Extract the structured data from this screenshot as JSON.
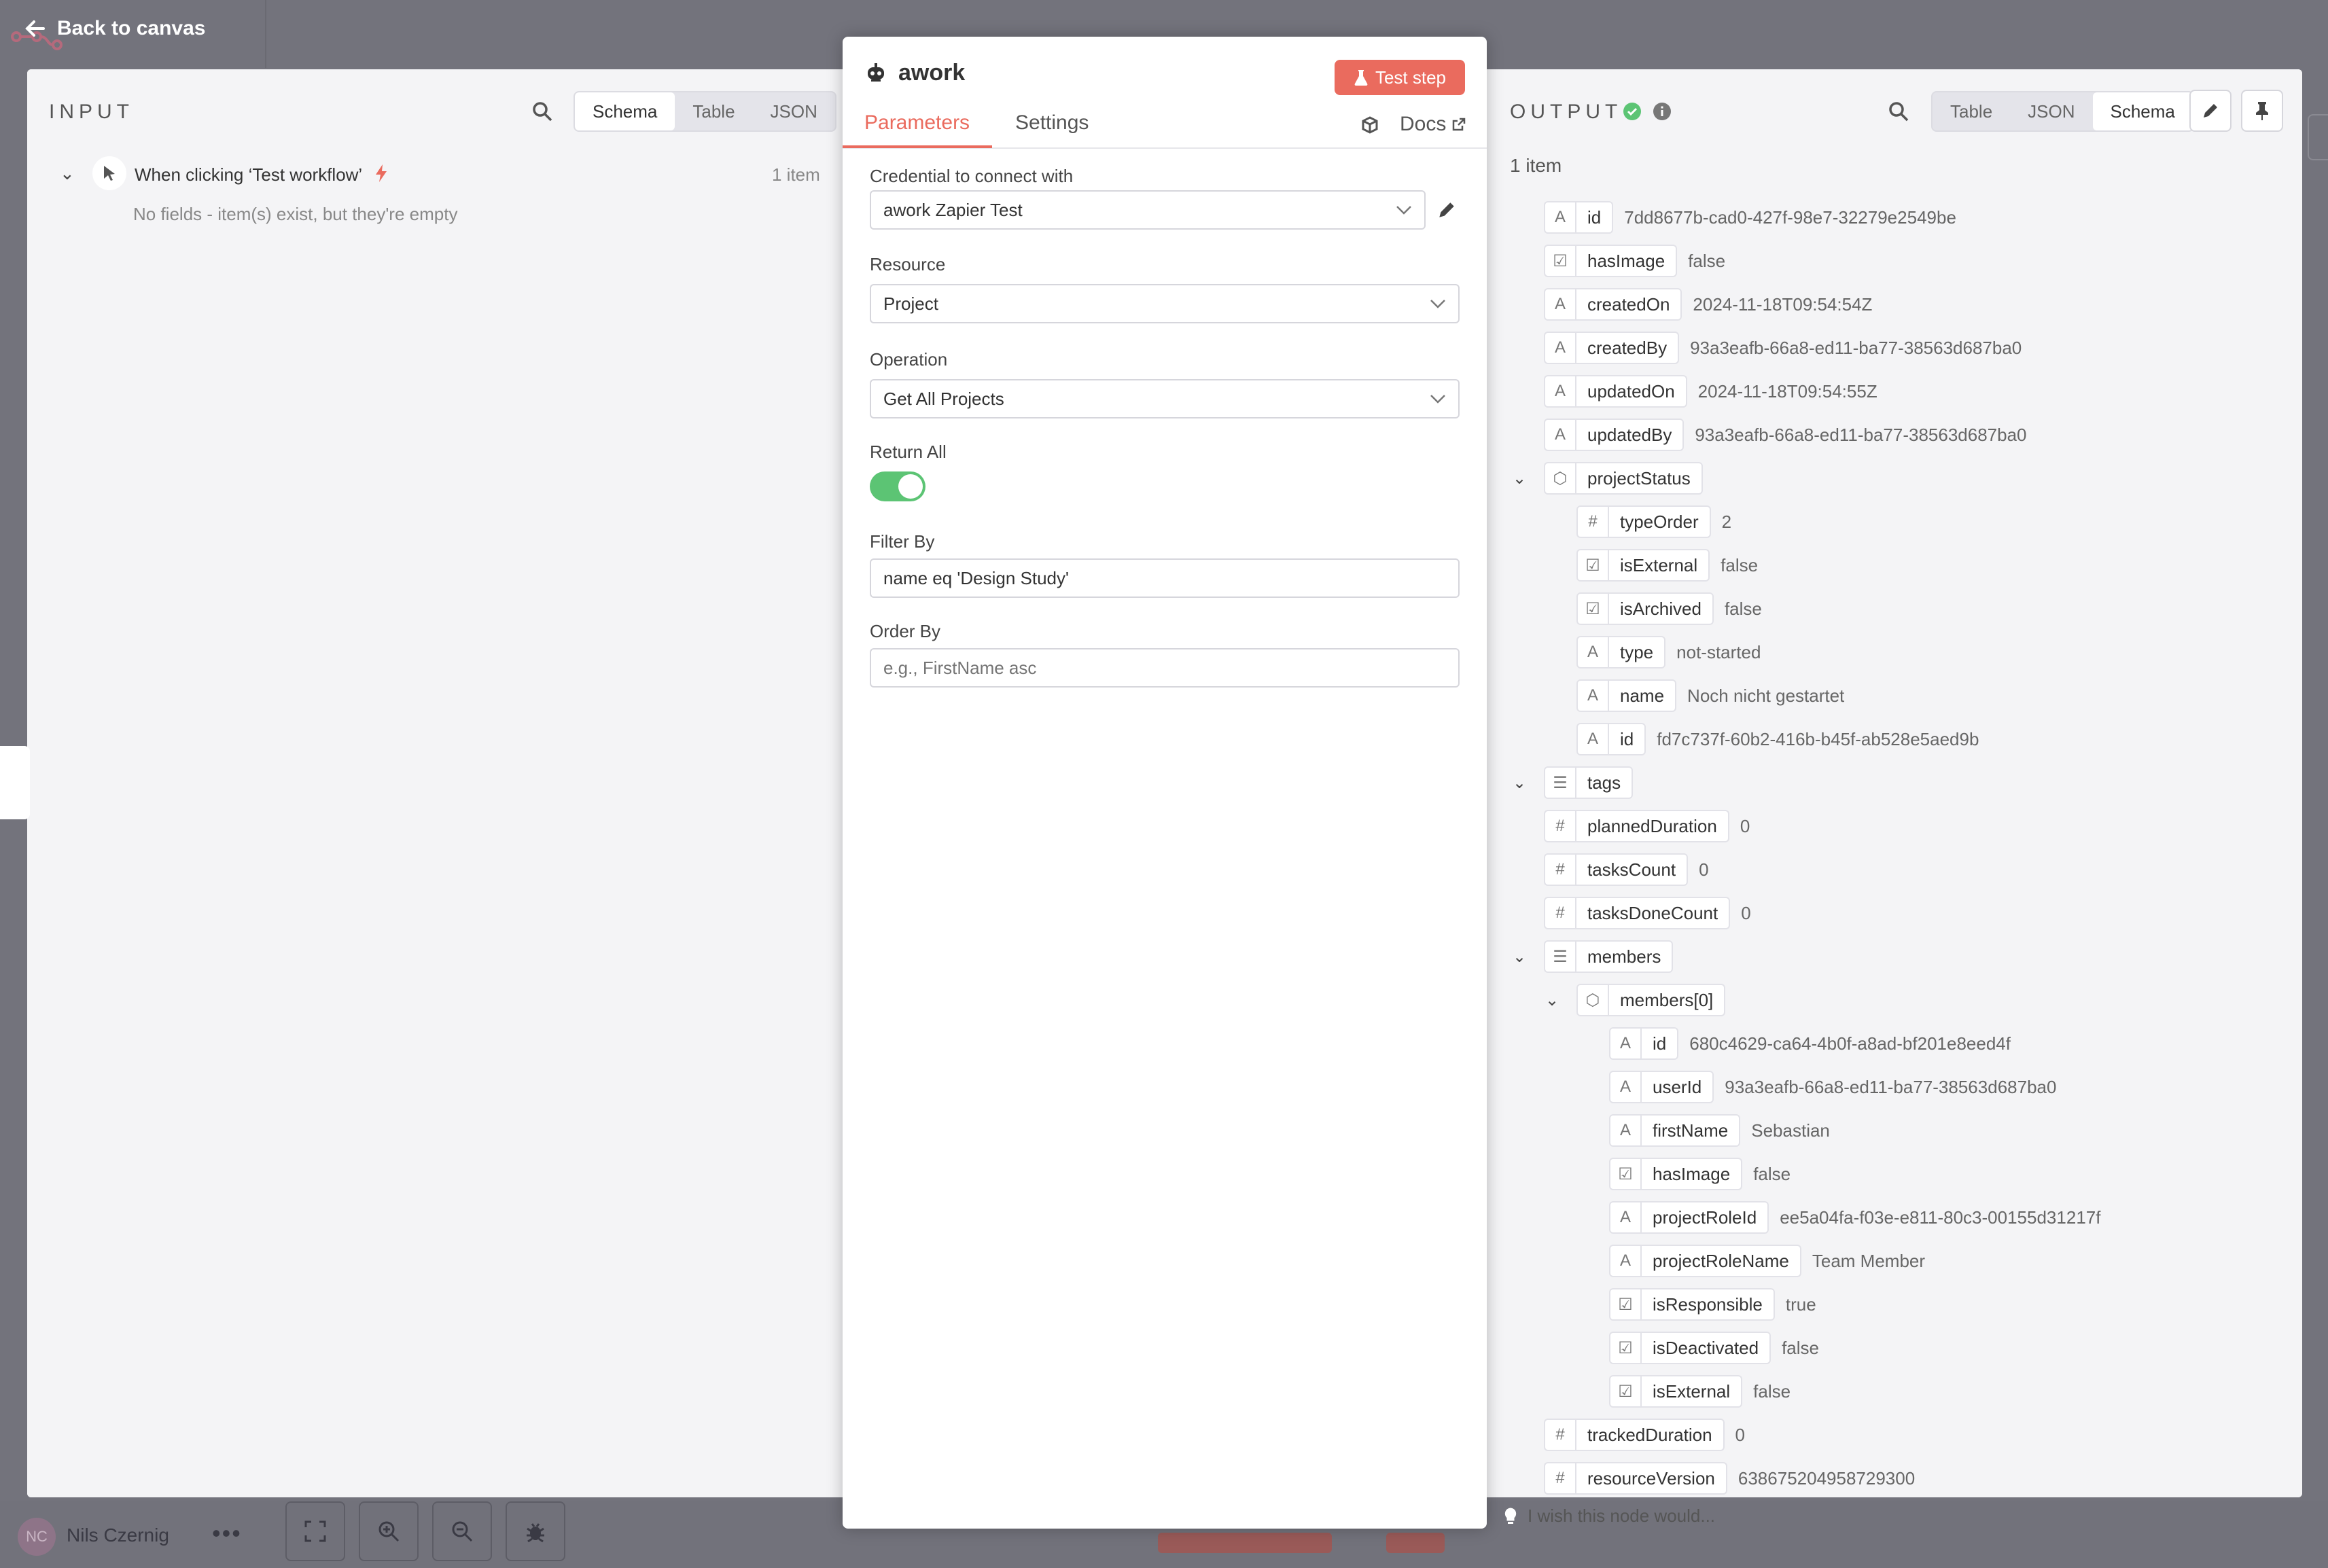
{
  "topbar": {
    "back_label": "Back to canvas"
  },
  "input": {
    "title": "INPUT",
    "view_tabs": [
      "Schema",
      "Table",
      "JSON"
    ],
    "active_tab": "Schema",
    "trigger_name": "When clicking ‘Test workflow’",
    "item_count": "1 item",
    "empty_message": "No fields - item(s) exist, but they're empty"
  },
  "node": {
    "name": "awork",
    "test_button": "Test step",
    "tabs": [
      "Parameters",
      "Settings"
    ],
    "docs_label": "Docs",
    "credential_label": "Credential to connect with",
    "credential_value": "awork Zapier Test",
    "resource_label": "Resource",
    "resource_value": "Project",
    "operation_label": "Operation",
    "operation_value": "Get All Projects",
    "return_all_label": "Return All",
    "return_all": true,
    "filter_label": "Filter By",
    "filter_value": "name eq 'Design Study'",
    "order_label": "Order By",
    "order_placeholder": "e.g., FirstName asc"
  },
  "output": {
    "title": "OUTPUT",
    "item_count": "1 item",
    "view_tabs": [
      "Table",
      "JSON",
      "Schema"
    ],
    "active_tab": "Schema",
    "fields": [
      {
        "type": "string",
        "key": "id",
        "value": "7dd8677b-cad0-427f-98e7-32279e2549be",
        "depth": 0
      },
      {
        "type": "boolean",
        "key": "hasImage",
        "value": "false",
        "depth": 0
      },
      {
        "type": "string",
        "key": "createdOn",
        "value": "2024-11-18T09:54:54Z",
        "depth": 0
      },
      {
        "type": "string",
        "key": "createdBy",
        "value": "93a3eafb-66a8-ed11-ba77-38563d687ba0",
        "depth": 0
      },
      {
        "type": "string",
        "key": "updatedOn",
        "value": "2024-11-18T09:54:55Z",
        "depth": 0
      },
      {
        "type": "string",
        "key": "updatedBy",
        "value": "93a3eafb-66a8-ed11-ba77-38563d687ba0",
        "depth": 0
      },
      {
        "type": "object",
        "key": "projectStatus",
        "value": "",
        "depth": 0,
        "expanded": true
      },
      {
        "type": "number",
        "key": "typeOrder",
        "value": "2",
        "depth": 1
      },
      {
        "type": "boolean",
        "key": "isExternal",
        "value": "false",
        "depth": 1
      },
      {
        "type": "boolean",
        "key": "isArchived",
        "value": "false",
        "depth": 1
      },
      {
        "type": "string",
        "key": "type",
        "value": "not-started",
        "depth": 1
      },
      {
        "type": "string",
        "key": "name",
        "value": "Noch nicht gestartet",
        "depth": 1
      },
      {
        "type": "string",
        "key": "id",
        "value": "fd7c737f-60b2-416b-b45f-ab528e5aed9b",
        "depth": 1
      },
      {
        "type": "array",
        "key": "tags",
        "value": "",
        "depth": 0,
        "expanded": true
      },
      {
        "type": "number",
        "key": "plannedDuration",
        "value": "0",
        "depth": 0
      },
      {
        "type": "number",
        "key": "tasksCount",
        "value": "0",
        "depth": 0
      },
      {
        "type": "number",
        "key": "tasksDoneCount",
        "value": "0",
        "depth": 0
      },
      {
        "type": "array",
        "key": "members",
        "value": "",
        "depth": 0,
        "expanded": true
      },
      {
        "type": "object",
        "key": "members[0]",
        "value": "",
        "depth": 1,
        "expanded": true
      },
      {
        "type": "string",
        "key": "id",
        "value": "680c4629-ca64-4b0f-a8ad-bf201e8eed4f",
        "depth": 2
      },
      {
        "type": "string",
        "key": "userId",
        "value": "93a3eafb-66a8-ed11-ba77-38563d687ba0",
        "depth": 2
      },
      {
        "type": "string",
        "key": "firstName",
        "value": "Sebastian",
        "depth": 2
      },
      {
        "type": "boolean",
        "key": "hasImage",
        "value": "false",
        "depth": 2
      },
      {
        "type": "string",
        "key": "projectRoleId",
        "value": "ee5a04fa-f03e-e811-80c3-00155d31217f",
        "depth": 2
      },
      {
        "type": "string",
        "key": "projectRoleName",
        "value": "Team Member",
        "depth": 2
      },
      {
        "type": "boolean",
        "key": "isResponsible",
        "value": "true",
        "depth": 2
      },
      {
        "type": "boolean",
        "key": "isDeactivated",
        "value": "false",
        "depth": 2
      },
      {
        "type": "boolean",
        "key": "isExternal",
        "value": "false",
        "depth": 2
      },
      {
        "type": "number",
        "key": "trackedDuration",
        "value": "0",
        "depth": 0
      },
      {
        "type": "number",
        "key": "resourceVersion",
        "value": "638675204958729300",
        "depth": 0
      }
    ],
    "feedback_label": "I wish this node would..."
  },
  "footer": {
    "user_initials": "NC",
    "user_name": "Nils Czernig"
  },
  "colors": {
    "accent": "#ea6b5e",
    "success": "#5cc474"
  }
}
